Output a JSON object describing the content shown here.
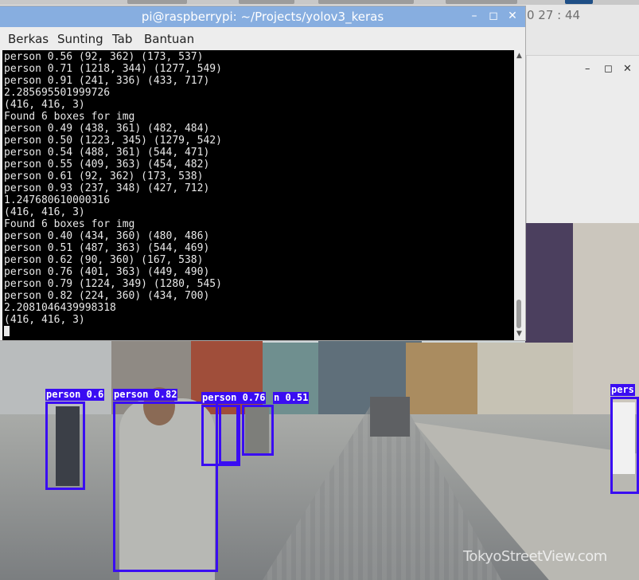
{
  "desktop": {
    "clock": "0 27 : 44",
    "bg_window_controls": {
      "minimize": "–",
      "maximize": "◻",
      "close": "✕"
    }
  },
  "terminal": {
    "title": "pi@raspberrypi: ~/Projects/yolov3_keras",
    "controls": {
      "minimize": "–",
      "maximize": "◻",
      "close": "✕"
    },
    "menu": [
      "Berkas",
      "Sunting",
      "Tab",
      "Bantuan"
    ],
    "lines": [
      "person 0.56 (92, 362) (173, 537)",
      "person 0.71 (1218, 344) (1277, 549)",
      "person 0.91 (241, 336) (433, 717)",
      "2.285695501999726",
      "(416, 416, 3)",
      "Found 6 boxes for img",
      "person 0.49 (438, 361) (482, 484)",
      "person 0.50 (1223, 345) (1279, 542)",
      "person 0.54 (488, 361) (544, 471)",
      "person 0.55 (409, 363) (454, 482)",
      "person 0.61 (92, 362) (173, 538)",
      "person 0.93 (237, 348) (427, 712)",
      "1.247680610000316",
      "(416, 416, 3)",
      "Found 6 boxes for img",
      "person 0.40 (434, 360) (480, 486)",
      "person 0.51 (487, 363) (544, 469)",
      "person 0.62 (90, 360) (167, 538)",
      "person 0.76 (401, 363) (449, 490)",
      "person 0.79 (1224, 349) (1280, 545)",
      "person 0.82 (224, 360) (434, 700)",
      "2.2081046439998318",
      "(416, 416, 3)"
    ],
    "scroll_up": "▲",
    "scroll_down": "▼"
  },
  "video": {
    "detections": [
      {
        "label": "person 0.6"
      },
      {
        "label": "person 0.82"
      },
      {
        "label": "person 0.76"
      },
      {
        "label": "n 0.51"
      },
      {
        "label": "pers"
      }
    ],
    "watermark": "TokyoStreetView.com"
  },
  "colors": {
    "titlebar": "#87aee0",
    "detection": "#3a0df2",
    "terminal_bg": "#000000"
  }
}
